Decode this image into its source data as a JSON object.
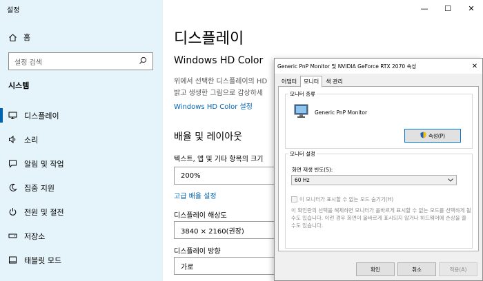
{
  "settings": {
    "window_title": "설정",
    "home_label": "홈",
    "search_placeholder": "설정 검색",
    "section_title": "시스템",
    "nav_items": [
      {
        "label": "디스플레이"
      },
      {
        "label": "소리"
      },
      {
        "label": "알림 및 작업"
      },
      {
        "label": "집중 지원"
      },
      {
        "label": "전원 및 절전"
      },
      {
        "label": "저장소"
      },
      {
        "label": "태블릿 모드"
      }
    ],
    "page_title": "디스플레이",
    "hd_color_heading": "Windows HD Color",
    "hd_color_desc_line1": "위에서 선택한 디스플레이의 HD",
    "hd_color_desc_line2": "밝고 생생한 그림으로 감상하세",
    "hd_color_link": "Windows HD Color 설정",
    "layout_heading": "배율 및 레이아웃",
    "scale_label": "텍스트, 앱 및 기타 항목의 크기",
    "scale_value": "200%",
    "advanced_scale_link": "고급 배율 설정",
    "resolution_label": "디스플레이 해상도",
    "resolution_value": "3840 × 2160(권장)",
    "orientation_label": "디스플레이 방향",
    "orientation_value": "가로"
  },
  "dialog": {
    "title": "Generic PnP Monitor 및 NVIDIA GeForce RTX 2070 속성",
    "tabs": [
      "어댑터",
      "모니터",
      "색 관리"
    ],
    "active_tab": 1,
    "monitor_type_group": "모니터 종류",
    "monitor_name": "Generic PnP Monitor",
    "properties_button": "속성(P)",
    "monitor_settings_group": "모니터 설정",
    "refresh_rate_label": "화면 재생 빈도(S):",
    "refresh_rate_value": "60 Hz",
    "hide_modes_label": "이 모니터가 표시할 수 없는 모드 숨기기(H)",
    "hide_modes_note": "이 확인란의 선택을 해제하면 모니터가 올바르게 표시할 수 없는 모드를 선택하게 될 수도 있습니다. 이런 경우 화면이 올바르게 표시되지 않거나 하드웨어에 손상을 줄 수도 있습니다.",
    "ok_button": "확인",
    "cancel_button": "취소",
    "apply_button": "적용(A)"
  },
  "colors": {
    "sidebar_bg": "#e5f3fb",
    "accent": "#0063b1"
  }
}
